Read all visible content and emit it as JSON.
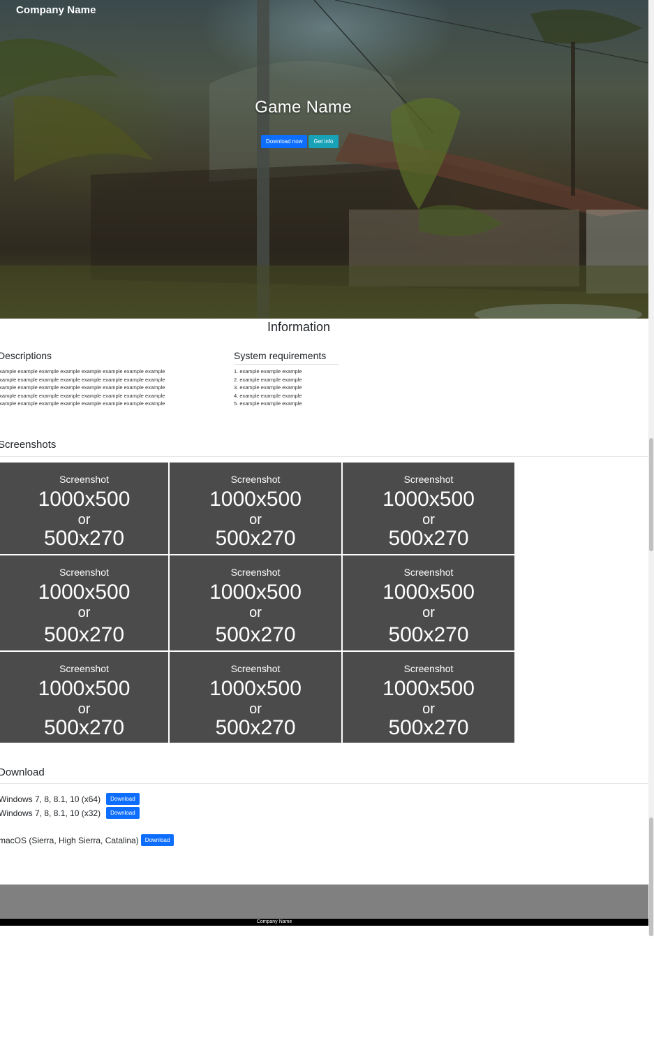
{
  "navbar": {
    "brand": "Company Name"
  },
  "hero": {
    "title": "Game Name",
    "download_button": "Download now",
    "info_button": "Get info"
  },
  "information": {
    "title": "Information",
    "descriptions": {
      "heading": "Descriptions",
      "lines": [
        "example example example example example example example example",
        "example example example example example example example example",
        "example example example example example example example example",
        "example example example example example example example example",
        "example example example example example example example example"
      ]
    },
    "system_requirements": {
      "heading": "System requirements",
      "items": [
        "1. example example example",
        "2. example example example",
        "3. example example example",
        "4. example example example",
        "5. example example example"
      ]
    }
  },
  "screenshots": {
    "heading": "Screenshots",
    "tile": {
      "label": "Screenshot",
      "size1": "1000x500",
      "or": "or",
      "size2": "500x270"
    },
    "count": 9
  },
  "download": {
    "heading": "Download",
    "items": [
      {
        "os": "Windows 7, 8, 8.1, 10 (x64)",
        "button": "Download"
      },
      {
        "os": "Windows 7, 8, 8.1, 10 (x32)",
        "button": "Download"
      },
      {
        "os": "macOS (Sierra, High Sierra, Catalina)",
        "button": "Download"
      }
    ]
  },
  "footer": {
    "text": "Company Name"
  },
  "colors": {
    "primary": "#0d6efd",
    "info": "#17a2b8",
    "tile_bg": "#4b4b4b",
    "footer_gray": "#808080",
    "footer_black": "#000000"
  }
}
